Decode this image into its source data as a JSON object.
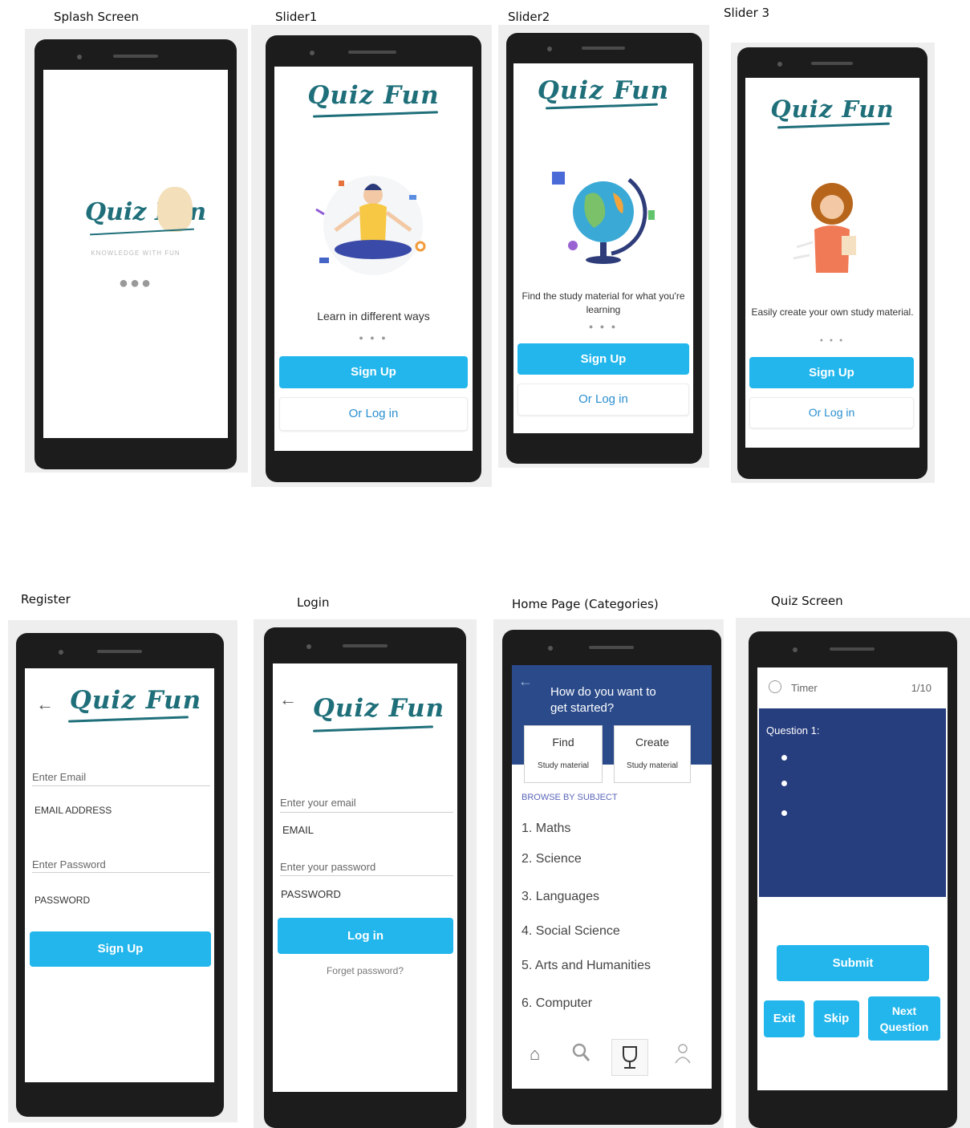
{
  "labels": {
    "splash": "Splash Screen",
    "slider1": "Slider1",
    "slider2": "Slider2",
    "slider3": "Slider 3",
    "register": "Register",
    "login": "Login",
    "home": "Home Page (Categories)",
    "quiz": "Quiz Screen"
  },
  "brand": {
    "name": "Quiz Fun",
    "tagline": "KNOWLEDGE WITH FUN",
    "color": "#1f6f7a",
    "accent": "#22b6ec"
  },
  "splash": {
    "dots": "●●●"
  },
  "slider1": {
    "caption": "Learn in different ways",
    "dots": "● ● ●",
    "signup": "Sign Up",
    "login": "Or Log in"
  },
  "slider2": {
    "caption": "Find the study material for what you're learning",
    "dots": "● ● ●",
    "signup": "Sign Up",
    "login": "Or Log in"
  },
  "slider3": {
    "caption": "Easily create your own study material.",
    "dots": "● ● ●",
    "signup": "Sign Up",
    "login": "Or Log in"
  },
  "register": {
    "email_label": "Enter Email",
    "email_value": "EMAIL ADDRESS",
    "password_label": "Enter Password",
    "password_value": "PASSWORD",
    "signup": "Sign Up"
  },
  "login": {
    "email_label": "Enter your email",
    "email_value": "EMAIL",
    "password_label": "Enter your password",
    "password_value": "PASSWORD",
    "login": "Log in",
    "forget": "Forget password?"
  },
  "home": {
    "question": "How do you want to get started?",
    "find": {
      "title": "Find",
      "sub": "Study material"
    },
    "create": {
      "title": "Create",
      "sub": "Study material"
    },
    "browse": "BROWSE BY SUBJECT",
    "categories": [
      "1. Maths",
      "2. Science",
      "3. Languages",
      "4. Social Science",
      "5. Arts and Humanities",
      "6. Computer"
    ],
    "nav_icons": [
      "home-icon",
      "search-icon",
      "trophy-icon",
      "user-icon"
    ]
  },
  "quiz": {
    "timer": "Timer",
    "progress": "1/10",
    "question": "Question 1:",
    "submit": "Submit",
    "exit": "Exit",
    "skip": "Skip",
    "next": "Next Question"
  }
}
